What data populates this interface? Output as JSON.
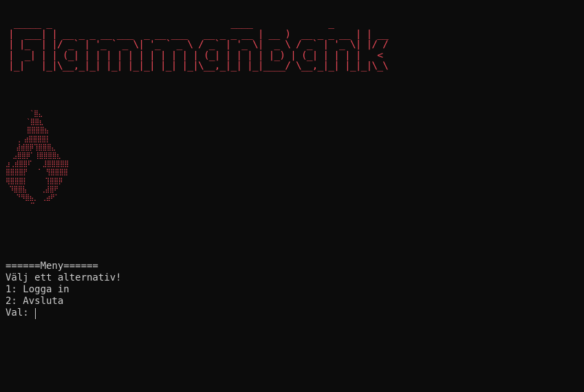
{
  "banner_ascii": " _____ _                                 ____              _    \n|  ___| | __ _ _ __ ___  _ __ ___   __ _ _ __ | __ )  __ _ _ __ | | __\n| |_  | |/ _` | '_ ` _ \\| '_ ` _ \\ / _` | '_ \\|  _ \\ / _` | '_ \\| |/ /\n|  _| | | (_| | | | | | | | | | | | (_| | | | | |_) | (_| | | | |   < \n|_|   |_|\\__,_|_| |_| |_|_| |_| |_|\\__,_|_| |_|____/ \\__,_|_| |_|_|\\_\\",
  "flame_ascii": "       `⣿⣄\n      `⣿⣿⣆\n      ⣿⣿⣿⣿⣦\n   ⢀ ⣴⣿⣿⣿⣿⡇\n   ⣼⣾⣿⡿⢹⣿⣿⣿⣄\n  ⣠⣿⣿⡿⠁⢸⣿⣿⣿⣿⣆\n⣰⢀⣾⣿⣿⠏   ⣸⣿⣿⣿⣿⣿\n⣿⣿⣿⣿⡟   ⠁ ⢻⣿⣿⣿⣿\n⢿⣿⣿⣿⡇     ⢹⣿⣿⡿\n ⠹⣿⣿⣧    ⢀⣼⣿⠟\n   ⠙⠻⣿⣦⡀ ⢀⣴⠟⠁\n       ⠉",
  "menu": {
    "header": "======Meny======",
    "prompt_text": "Välj ett alternativ!",
    "option_1": "1: Logga in",
    "option_2": "2: Avsluta",
    "input_label": "Val: ",
    "input_value": ""
  },
  "colors": {
    "background": "#0c0c0c",
    "accent_red": "#e74856",
    "text": "#cccccc"
  }
}
